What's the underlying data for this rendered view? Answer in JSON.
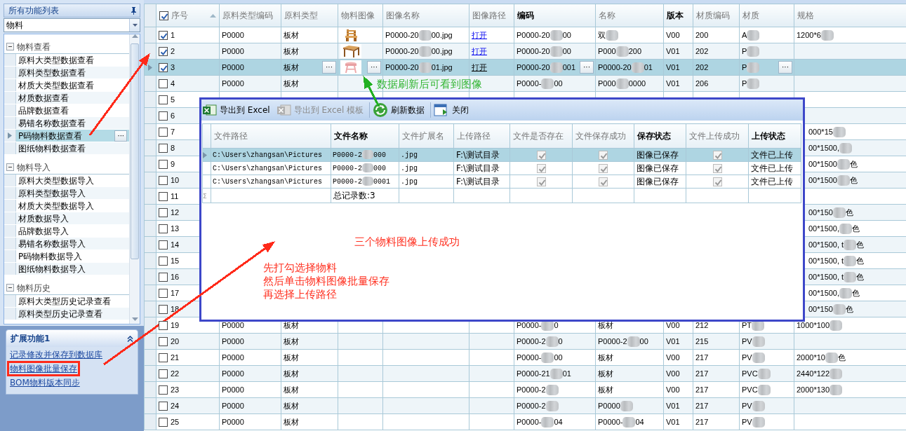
{
  "sidebar": {
    "title": "所有功能列表",
    "filter": "物料",
    "more_button": "···",
    "groups": [
      {
        "label": "物料查看",
        "expanded": true,
        "items": [
          {
            "label": "原料大类型数据查看",
            "selected": false
          },
          {
            "label": "原料类型数据查看",
            "selected": false
          },
          {
            "label": "材质大类型数据查看",
            "selected": false
          },
          {
            "label": "材质数据查看",
            "selected": false
          },
          {
            "label": "品牌数据查看",
            "selected": false
          },
          {
            "label": "易错名称数据查看",
            "selected": false
          },
          {
            "label": "P码物料数据查看",
            "selected": true
          },
          {
            "label": "图纸物料数据查看",
            "selected": false
          }
        ]
      },
      {
        "label": "物料导入",
        "expanded": true,
        "items": [
          {
            "label": "原料大类型数据导入",
            "selected": false
          },
          {
            "label": "原料类型数据导入",
            "selected": false
          },
          {
            "label": "材质大类型数据导入",
            "selected": false
          },
          {
            "label": "材质数据导入",
            "selected": false
          },
          {
            "label": "品牌数据导入",
            "selected": false
          },
          {
            "label": "易错名称数据导入",
            "selected": false
          },
          {
            "label": "P码物料数据导入",
            "selected": false
          },
          {
            "label": "图纸物料数据导入",
            "selected": false
          }
        ]
      },
      {
        "label": "物料历史",
        "expanded": true,
        "items": [
          {
            "label": "原料大类型历史记录查看",
            "selected": false
          },
          {
            "label": "原料类型历史记录查看",
            "selected": false
          }
        ]
      }
    ],
    "extension_panel": {
      "title": "扩展功能1",
      "expanded": true,
      "links": [
        "记录修改并保存到数据库",
        "物料图像批量保存",
        "BOM物料版本同步"
      ]
    }
  },
  "grid": {
    "header_checked": true,
    "editor_button": "···",
    "columns": [
      {
        "label": "序号",
        "bold": false,
        "sorted": true
      },
      {
        "label": "原料类型编码",
        "bold": false
      },
      {
        "label": "原料类型",
        "bold": false
      },
      {
        "label": "物料图像",
        "bold": false
      },
      {
        "label": "图像名称",
        "bold": false
      },
      {
        "label": "图像路径",
        "bold": false
      },
      {
        "label": "编码",
        "bold": true
      },
      {
        "label": "名称",
        "bold": false
      },
      {
        "label": "版本",
        "bold": true
      },
      {
        "label": "材质编码",
        "bold": false
      },
      {
        "label": "材质",
        "bold": false
      },
      {
        "label": "规格",
        "bold": false
      }
    ],
    "rows": [
      {
        "no": "1",
        "checked": true,
        "selected": false,
        "cells": [
          "P0000",
          "板材",
          {
            "kind": "picture"
          },
          {
            "before": "P0000-20",
            "after": "00.jpg"
          },
          "打开",
          {
            "before": "P0000-20",
            "after": "00"
          },
          {
            "before": "双"
          },
          "V00",
          "200",
          {
            "before": "A"
          },
          {
            "before": "1200*6"
          }
        ]
      },
      {
        "no": "2",
        "checked": true,
        "selected": false,
        "cells": [
          "P0000",
          "板材",
          {
            "kind": "picture"
          },
          {
            "before": "P0000-20",
            "after": "00.jpg"
          },
          "打开",
          {
            "before": "P0000-20",
            "after": "00"
          },
          {
            "before": "P000",
            "after": "200"
          },
          "V01",
          "202",
          {
            "before": "P"
          },
          null
        ]
      },
      {
        "no": "3",
        "checked": true,
        "selected": true,
        "cells": [
          "P0000",
          "板材",
          {
            "kind": "picture"
          },
          {
            "before": "P0000-20",
            "after": "01.jpg"
          },
          "打开",
          {
            "before": "P0000-20",
            "after": "001"
          },
          {
            "before": "P0000-20",
            "after": "01"
          },
          "V01",
          "202",
          {
            "before": "P"
          },
          null
        ]
      },
      {
        "no": "4",
        "checked": false,
        "selected": false,
        "cells": [
          "P0000",
          "板材",
          null,
          null,
          null,
          {
            "before": "P0000-",
            "after": "00"
          },
          {
            "before": "P000",
            "after": "0000"
          },
          "V01",
          "206",
          {
            "before": "P"
          },
          null
        ]
      },
      {
        "no": "5",
        "checked": false,
        "selected": false
      },
      {
        "no": "6",
        "checked": false,
        "selected": false
      },
      {
        "no": "7",
        "checked": false,
        "selected": false,
        "spec_tail": "000*15"
      },
      {
        "no": "8",
        "checked": false,
        "selected": false,
        "spec_tail": "00*1500,"
      },
      {
        "no": "9",
        "checked": false,
        "selected": false,
        "spec_tail": "00*1500",
        "spec_end": "色"
      },
      {
        "no": "10",
        "checked": false,
        "selected": false,
        "spec_tail": "00*1500",
        "spec_end": "色"
      },
      {
        "no": "11",
        "checked": false,
        "selected": false
      },
      {
        "no": "12",
        "checked": false,
        "selected": false,
        "spec_tail": "00*150",
        "spec_end": "色"
      },
      {
        "no": "13",
        "checked": false,
        "selected": false,
        "spec_tail": "00*1500,",
        "spec_end": "色"
      },
      {
        "no": "14",
        "checked": false,
        "selected": false,
        "spec_tail": "00*1500, t",
        "spec_end": "色"
      },
      {
        "no": "15",
        "checked": false,
        "selected": false,
        "spec_tail": "00*1500, t",
        "spec_end": "色"
      },
      {
        "no": "16",
        "checked": false,
        "selected": false,
        "spec_tail": "00*1500, t",
        "spec_end": "色"
      },
      {
        "no": "17",
        "checked": false,
        "selected": false,
        "spec_tail": "00*1500,",
        "spec_end": "色"
      },
      {
        "no": "18",
        "checked": false,
        "selected": false,
        "spec_tail": "00*150",
        "spec_end": "色"
      },
      {
        "no": "19",
        "checked": false,
        "selected": false,
        "cells": [
          "P0000",
          "板材",
          null,
          null,
          null,
          {
            "before": "P0000-",
            "after": "0"
          },
          "板材",
          "V00",
          "212",
          {
            "before": "PT"
          },
          {
            "before": "1000*100"
          }
        ]
      },
      {
        "no": "20",
        "checked": false,
        "selected": false,
        "cells": [
          "P0000",
          "板材",
          null,
          null,
          null,
          {
            "before": "P0000-2",
            "after": "0"
          },
          {
            "before": "P0000-2",
            "after": "00"
          },
          "V01",
          "215",
          {
            "before": "PV"
          },
          null
        ]
      },
      {
        "no": "21",
        "checked": false,
        "selected": false,
        "cells": [
          "P0000",
          "板材",
          null,
          null,
          null,
          {
            "before": "P0000-",
            "after": "00"
          },
          "板材",
          "V00",
          "217",
          {
            "before": "PV"
          },
          {
            "before": "2000*10",
            "after": "色"
          }
        ]
      },
      {
        "no": "22",
        "checked": false,
        "selected": false,
        "cells": [
          "P0000",
          "板材",
          null,
          null,
          null,
          {
            "before": "P0000-21",
            "after": "01"
          },
          "板材",
          "V00",
          "217",
          {
            "before": "PVC"
          },
          {
            "before": "2440*122"
          }
        ]
      },
      {
        "no": "23",
        "checked": false,
        "selected": false,
        "cells": [
          "P0000",
          "板材",
          null,
          null,
          null,
          {
            "before": "P0000-2"
          },
          "板材",
          "V00",
          "217",
          {
            "before": "PVC"
          },
          {
            "before": "2000*130"
          }
        ]
      },
      {
        "no": "24",
        "checked": false,
        "selected": false,
        "cells": [
          "P0000",
          "板材",
          null,
          null,
          null,
          {
            "before": "P0000-2"
          },
          {
            "before": "P0000"
          },
          "V01",
          "217",
          {
            "before": "PV"
          },
          null
        ]
      },
      {
        "no": "25",
        "checked": false,
        "selected": false,
        "cells": [
          "P0000",
          "板材",
          null,
          null,
          null,
          {
            "before": "P0000-",
            "after": "04"
          },
          {
            "before": "P0000-",
            "after": "04"
          },
          "V01",
          "217",
          {
            "before": "PV"
          },
          null
        ]
      }
    ]
  },
  "dialog": {
    "toolbar": [
      {
        "label": "导出到 Excel",
        "kind": "excel",
        "disabled": false
      },
      {
        "label": "导出到 Excel 模板",
        "kind": "excel",
        "disabled": true
      },
      {
        "label": "刷新数据",
        "kind": "refresh",
        "disabled": false
      },
      {
        "label": "关闭",
        "kind": "close",
        "disabled": false
      }
    ],
    "columns": [
      {
        "label": "文件路径",
        "bold": false
      },
      {
        "label": "文件名称",
        "bold": true
      },
      {
        "label": "文件扩展名",
        "bold": false
      },
      {
        "label": "上传路径",
        "bold": false
      },
      {
        "label": "文件是否存在",
        "bold": false
      },
      {
        "label": "文件保存成功",
        "bold": false
      },
      {
        "label": "保存状态",
        "bold": true
      },
      {
        "label": "文件上传成功",
        "bold": false
      },
      {
        "label": "上传状态",
        "bold": true
      }
    ],
    "rows": [
      {
        "selected": true,
        "path": "C:\\Users\\zhangsan\\Pictures",
        "name": {
          "before": "P0000-2",
          "after": "000"
        },
        "ext": ".jpg",
        "upload_path": "F:\\测试目录",
        "exists": true,
        "saved": true,
        "save_status": "图像已保存",
        "uploaded": true,
        "upload_status": "文件已上传"
      },
      {
        "selected": false,
        "path": "C:\\Users\\zhangsan\\Pictures",
        "name": {
          "before": "P0000-2",
          "after": "000"
        },
        "ext": ".jpg",
        "upload_path": "F:\\测试目录",
        "exists": true,
        "saved": true,
        "save_status": "图像已保存",
        "uploaded": true,
        "upload_status": "文件已上传"
      },
      {
        "selected": false,
        "path": "C:\\Users\\zhangsan\\Pictures",
        "name": {
          "before": "P0000-2",
          "after": "0001"
        },
        "ext": ".jpg",
        "upload_path": "F:\\测试目录",
        "exists": true,
        "saved": true,
        "save_status": "图像已保存",
        "uploaded": true,
        "upload_status": "文件已上传"
      }
    ],
    "summary_mark": "Σ",
    "total": "总记录数:3"
  },
  "annotations": {
    "notes": [
      {
        "lines": [
          "数据刷新后可看到图像"
        ],
        "color": "#33b533"
      },
      {
        "lines": [
          "三个物料图像上传成功"
        ],
        "color": "#ff3020"
      },
      {
        "lines": [
          "先打勾选择物料",
          "然后单击物料图像批量保存",
          "再选择上传路径"
        ],
        "color": "#ff3020"
      }
    ],
    "arrows": [
      {
        "color": "#ff2a1a"
      },
      {
        "color": "#ff2a1a"
      },
      {
        "color": "#22b022"
      }
    ],
    "frame": {
      "color": "#ff2a1a"
    }
  }
}
